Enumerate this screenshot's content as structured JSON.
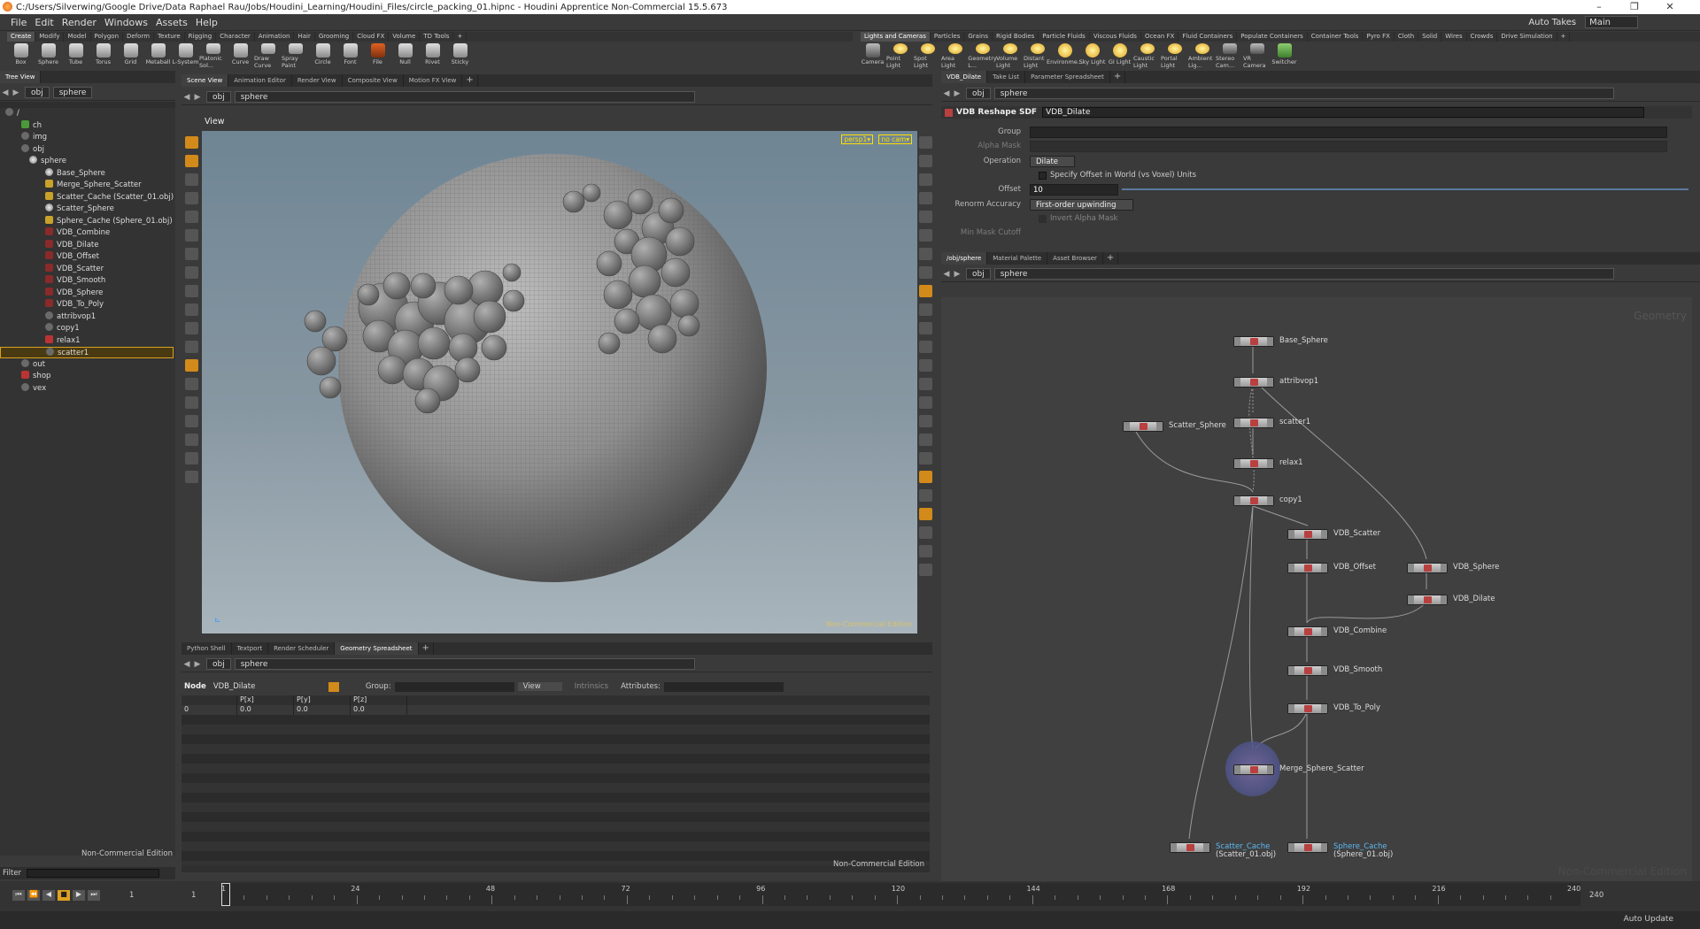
{
  "window": {
    "title": "C:/Users/Silverwing/Google Drive/Data Raphael Rau/Jobs/Houdini_Learning/Houdini_Files/circle_packing_01.hipnc - Houdini Apprentice Non-Commercial 15.5.673",
    "min": "–",
    "max": "❐",
    "close": "✕"
  },
  "menu": {
    "items": [
      "File",
      "Edit",
      "Render",
      "Windows",
      "Assets",
      "Help"
    ],
    "auto_takes": "Auto Takes",
    "desktop": "Main"
  },
  "shelf_left": {
    "tabs": [
      "Create",
      "Modify",
      "Model",
      "Polygon",
      "Deform",
      "Texture",
      "Rigging",
      "Character",
      "Animation",
      "Hair",
      "Grooming",
      "Cloud FX",
      "Volume",
      "TD Tools",
      "+"
    ],
    "tools": [
      "Box",
      "Sphere",
      "Tube",
      "Torus",
      "Grid",
      "Metaball",
      "L-System",
      "Platonic Sol...",
      "Curve",
      "Draw Curve",
      "Spray Paint",
      "Circle",
      "Font",
      "File",
      "Null",
      "Rivet",
      "Sticky"
    ]
  },
  "shelf_right": {
    "tabs": [
      "Lights and Cameras",
      "Particles",
      "Grains",
      "Rigid Bodies",
      "Particle Fluids",
      "Viscous Fluids",
      "Ocean FX",
      "Fluid Containers",
      "Populate Containers",
      "Container Tools",
      "Pyro FX",
      "Cloth",
      "Solid",
      "Wires",
      "Crowds",
      "Drive Simulation",
      "+"
    ],
    "tools": [
      "Camera",
      "Point Light",
      "Spot Light",
      "Area Light",
      "Geometry L...",
      "Volume Light",
      "Distant Light",
      "Environme...",
      "Sky Light",
      "GI Light",
      "Caustic Light",
      "Portal Light",
      "Ambient Lig...",
      "Stereo Cam...",
      "VR Camera",
      "Switcher"
    ]
  },
  "tree": {
    "tab": "Tree View",
    "path_obj": "obj",
    "path_node": "sphere",
    "filter_label": "Filter",
    "nce": "Non-Commercial Edition",
    "rows": [
      {
        "label": "/",
        "indent": 0,
        "icon": "net"
      },
      {
        "label": "ch",
        "indent": 2,
        "icon": "grn"
      },
      {
        "label": "img",
        "indent": 2,
        "icon": "net"
      },
      {
        "label": "obj",
        "indent": 2,
        "icon": "net"
      },
      {
        "label": "sphere",
        "indent": 3,
        "icon": "sph"
      },
      {
        "label": "Base_Sphere",
        "indent": 5,
        "icon": "sph"
      },
      {
        "label": "Merge_Sphere_Scatter",
        "indent": 5,
        "icon": "yel"
      },
      {
        "label": "Scatter_Cache (Scatter_01.obj)",
        "indent": 5,
        "icon": "yel"
      },
      {
        "label": "Scatter_Sphere",
        "indent": 5,
        "icon": "sph"
      },
      {
        "label": "Sphere_Cache (Sphere_01.obj)",
        "indent": 5,
        "icon": "yel"
      },
      {
        "label": "VDB_Combine",
        "indent": 5,
        "icon": "vdb"
      },
      {
        "label": "VDB_Dilate",
        "indent": 5,
        "icon": "vdb"
      },
      {
        "label": "VDB_Offset",
        "indent": 5,
        "icon": "vdb"
      },
      {
        "label": "VDB_Scatter",
        "indent": 5,
        "icon": "vdb"
      },
      {
        "label": "VDB_Smooth",
        "indent": 5,
        "icon": "vdb"
      },
      {
        "label": "VDB_Sphere",
        "indent": 5,
        "icon": "vdb"
      },
      {
        "label": "VDB_To_Poly",
        "indent": 5,
        "icon": "vdb"
      },
      {
        "label": "attribvop1",
        "indent": 5,
        "icon": "net"
      },
      {
        "label": "copy1",
        "indent": 5,
        "icon": "net"
      },
      {
        "label": "relax1",
        "indent": 5,
        "icon": "red"
      },
      {
        "label": "scatter1",
        "indent": 5,
        "icon": "net"
      },
      {
        "label": "out",
        "indent": 2,
        "icon": "net"
      },
      {
        "label": "shop",
        "indent": 2,
        "icon": "red"
      },
      {
        "label": "vex",
        "indent": 2,
        "icon": "net"
      }
    ]
  },
  "scene": {
    "tabs": [
      "Scene View",
      "Animation Editor",
      "Render View",
      "Composite View",
      "Motion FX View",
      "+"
    ],
    "path_obj": "obj",
    "path_node": "sphere",
    "title": "View",
    "cam": "persp1▾",
    "nocam": "no cam▾",
    "nce": "Non-Commercial Edition"
  },
  "params": {
    "tabs": [
      "VDB_Dilate",
      "Take List",
      "Parameter Spreadsheet",
      "+"
    ],
    "path_obj": "obj",
    "path_node": "sphere",
    "node_type": "VDB Reshape SDF",
    "node_name": "VDB_Dilate",
    "group_label": "Group",
    "alpha_label": "Alpha Mask",
    "operation_label": "Operation",
    "operation_value": "Dilate",
    "world_label": "Specify Offset in World (vs Voxel) Units",
    "offset_label": "Offset",
    "offset_value": "10",
    "renorm_label": "Renorm Accuracy",
    "renorm_value": "First-order upwinding",
    "invert_label": "Invert Alpha Mask",
    "minmask_label": "Min Mask Cutoff"
  },
  "network": {
    "tabs": [
      "/obj/sphere",
      "Material Palette",
      "Asset Browser",
      "+"
    ],
    "path_obj": "obj",
    "path_node": "sphere",
    "context": "Geometry",
    "nce": "Non-Commercial Edition",
    "nodes": {
      "base": "Base_Sphere",
      "attribvop": "attribvop1",
      "scatter_sphere": "Scatter_Sphere",
      "scatter": "scatter1",
      "relax": "relax1",
      "copy": "copy1",
      "vdb_scatter": "VDB_Scatter",
      "vdb_sphere": "VDB_Sphere",
      "vdb_offset": "VDB_Offset",
      "vdb_dilate": "VDB_Dilate",
      "vdb_combine": "VDB_Combine",
      "vdb_smooth": "VDB_Smooth",
      "vdb_topoly": "VDB_To_Poly",
      "merge": "Merge_Sphere_Scatter",
      "scatter_cache": "Scatter_Cache",
      "scatter_cache_file": "(Scatter_01.obj)",
      "sphere_cache": "Sphere_Cache",
      "sphere_cache_file": "(Sphere_01.obj)"
    }
  },
  "spread": {
    "tabs": [
      "Python Shell",
      "Textport",
      "Render Scheduler",
      "Geometry Spreadsheet",
      "+"
    ],
    "path_obj": "obj",
    "path_node": "sphere",
    "node_label": "Node",
    "node_value": "VDB_Dilate",
    "group_label": "Group:",
    "view": "View",
    "intrinsics": "Intrinsics",
    "attributes": "Attributes:",
    "headers": [
      "",
      "P[x]",
      "P[y]",
      "P[z]"
    ],
    "row": [
      "0",
      "0.0",
      "0.0",
      "0.0"
    ],
    "nce": "Non-Commercial Edition"
  },
  "timeline": {
    "frame": "1",
    "start": "1",
    "end": "240",
    "ticks": [
      "1",
      "24",
      "48",
      "72",
      "96",
      "120",
      "144",
      "168",
      "192",
      "216",
      "240"
    ],
    "auto_update": "Auto Update"
  }
}
